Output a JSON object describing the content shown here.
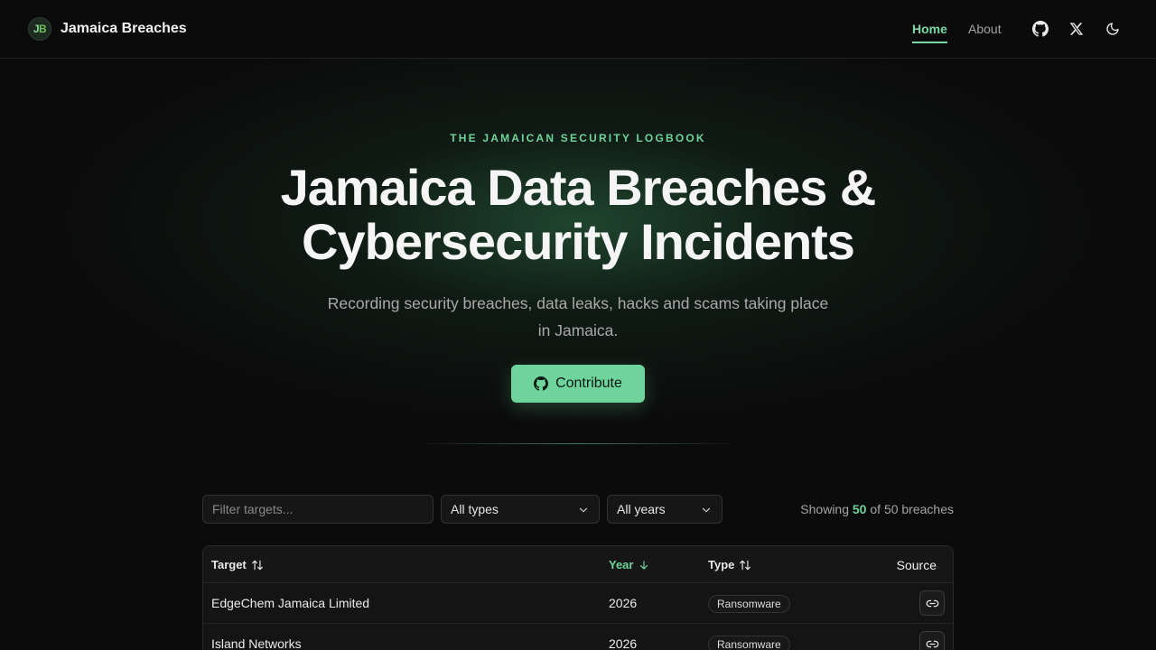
{
  "header": {
    "brand_logo_j": "J",
    "brand_logo_b": "B",
    "brand_name": "Jamaica Breaches",
    "nav": {
      "home": "Home",
      "about": "About"
    },
    "icons": [
      "github-icon",
      "x-icon",
      "moon-icon"
    ]
  },
  "hero": {
    "eyebrow": "THE JAMAICAN SECURITY LOGBOOK",
    "title": "Jamaica Data Breaches & Cybersecurity Incidents",
    "subtitle": "Recording security breaches, data leaks, hacks and scams taking place in Jamaica.",
    "cta": "Contribute"
  },
  "filters": {
    "search_placeholder": "Filter targets...",
    "type_selected": "All types",
    "year_selected": "All years",
    "showing_prefix": "Showing",
    "showing_count": "50",
    "showing_middle": "of",
    "showing_total": "50 breaches"
  },
  "table": {
    "headers": {
      "target": "Target",
      "year": "Year",
      "type": "Type",
      "source": "Source"
    },
    "rows": [
      {
        "target": "EdgeChem Jamaica Limited",
        "year": "2026",
        "type": "Ransomware"
      },
      {
        "target": "Island Networks",
        "year": "2026",
        "type": "Ransomware"
      }
    ]
  },
  "colors": {
    "accent": "#6fd39a",
    "background": "#0b0b0b",
    "button": "#6fd49c"
  }
}
